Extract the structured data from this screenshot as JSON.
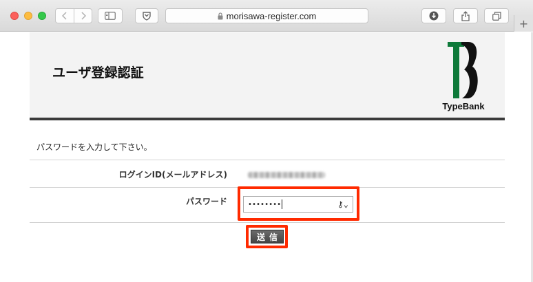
{
  "browser": {
    "url": "morisawa-register.com",
    "new_tab_label": "+",
    "icons": [
      "back-icon",
      "forward-icon",
      "sidebar-icon",
      "shield-icon",
      "lock-icon",
      "download-icon",
      "share-icon",
      "tabs-icon"
    ]
  },
  "page": {
    "title": "ユーザ登録認証",
    "logo_text": "TypeBank",
    "instruction": "パスワードを入力して下さい。",
    "fields": {
      "login_id_label": "ログインID(メールアドレス)",
      "password_label": "パスワード",
      "password_value": "••••••••"
    },
    "submit_label": "送信"
  },
  "colors": {
    "highlight": "#ff2a00",
    "logo_green": "#0e7a3a",
    "header_border": "#3a3a3a"
  }
}
